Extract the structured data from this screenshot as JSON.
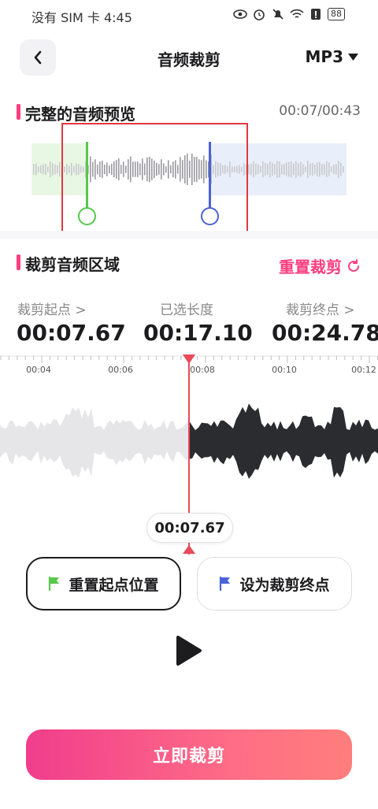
{
  "status_bar": {
    "carrier_time": "没有 SIM 卡 4:45",
    "battery": "88"
  },
  "header": {
    "title": "音频裁剪",
    "format": "MP3"
  },
  "preview": {
    "title": "完整的音频预览",
    "time": "00:07/00:43"
  },
  "trim": {
    "title": "裁剪音频区域",
    "reset_label": "重置裁剪",
    "start_label": "裁剪起点 >",
    "start_value": "00:07.67",
    "length_label": "已选长度",
    "length_value": "00:17.10",
    "end_label": "裁剪终点 >",
    "end_value": "00:24.78"
  },
  "timeline": {
    "ticks": [
      "00:04",
      "00:06",
      "00:08",
      "00:10",
      "00:12"
    ]
  },
  "playhead": {
    "time": "00:07.67"
  },
  "buttons": {
    "reset_start": "重置起点位置",
    "set_end": "设为裁剪终点",
    "cta": "立即裁剪"
  },
  "colors": {
    "accent": "#ff3d7f",
    "start_handle": "#56c94a",
    "end_handle": "#4a62d6",
    "playhead": "#e84a57"
  }
}
